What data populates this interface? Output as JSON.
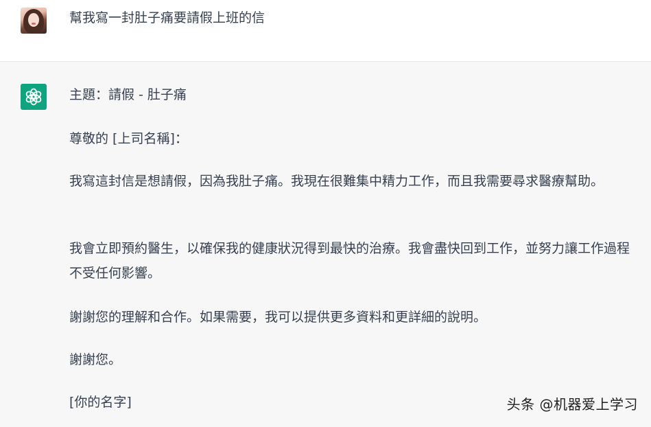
{
  "user_message": {
    "text": "幫我寫一封肚子痛要請假上班的信"
  },
  "assistant_message": {
    "subject": "主題：請假 - 肚子痛",
    "greeting": "尊敬的 [上司名稱]：",
    "paragraph_1": "我寫這封信是想請假，因為我肚子痛。我現在很難集中精力工作，而且我需要尋求醫療幫助。",
    "paragraph_2": "我會立即預約醫生，以確保我的健康狀況得到最快的治療。我會盡快回到工作，並努力讓工作過程不受任何影響。",
    "paragraph_3": "謝謝您的理解和合作。如果需要，我可以提供更多資料和更詳細的說明。",
    "closing": "謝謝您。",
    "signature": "[你的名字]"
  },
  "watermark": "头条 @机器爱上学习",
  "icons": {
    "user": "user-avatar",
    "assistant": "chatgpt-logo-icon"
  },
  "colors": {
    "assistant_icon_bg": "#10a37f",
    "assistant_row_bg": "#f7f7f8",
    "text": "#374151"
  }
}
